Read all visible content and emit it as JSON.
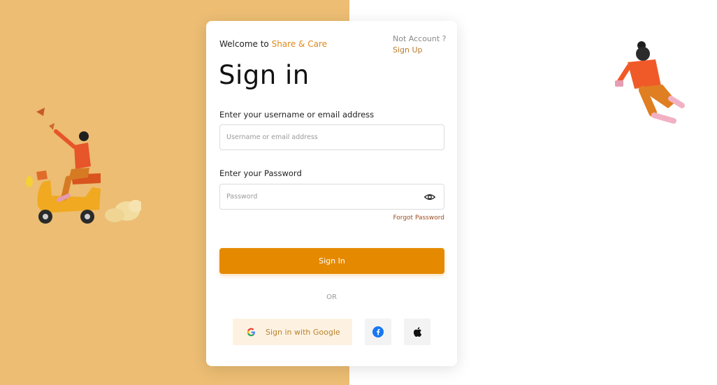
{
  "welcome": {
    "prefix": "Welcome to ",
    "brand": "Share & Care"
  },
  "account": {
    "prompt": "Not Account ?",
    "signup_label": "Sign Up"
  },
  "page_title": "Sign in",
  "username": {
    "label": "Enter your username or email address",
    "placeholder": "Username or email address",
    "value": ""
  },
  "password": {
    "label": "Enter your Password",
    "placeholder": "Password",
    "value": ""
  },
  "forgot_label": "Forgot Password",
  "signin_label": "Sign In",
  "divider_label": "OR",
  "social": {
    "google_label": "Sign in with Google"
  },
  "icons": {
    "password_toggle": "eye-icon",
    "google": "google-icon",
    "facebook": "facebook-icon",
    "apple": "apple-icon"
  },
  "colors": {
    "accent": "#e58a00",
    "left_panel": "#ecbd73",
    "brand_text": "#e0891a",
    "google_button_bg": "#fdf2e2",
    "link": "#b97a2c",
    "facebook": "#1877f2"
  }
}
